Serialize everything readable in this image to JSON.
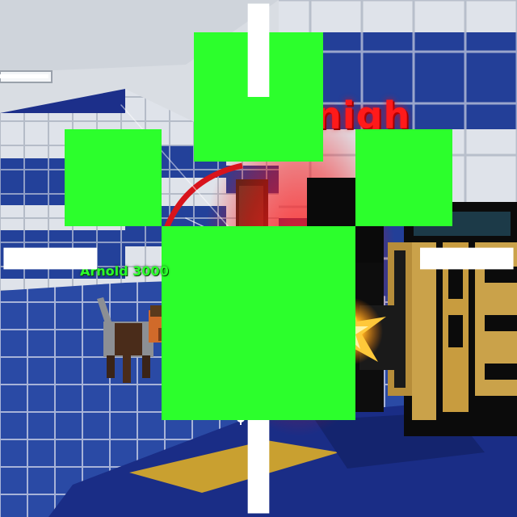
{
  "hud": {
    "enemy_player_name": "wonigh",
    "ally_pet_name": "Arnold 3000",
    "ally_icon": "paw-icon",
    "crosshair_icon": "crosshair-icon"
  },
  "colors": {
    "enemy_name": "#ff1a1a",
    "ally_name": "#2cff2c",
    "tile_blue": "#1f3f9a",
    "tile_white": "#e4e8ee"
  }
}
